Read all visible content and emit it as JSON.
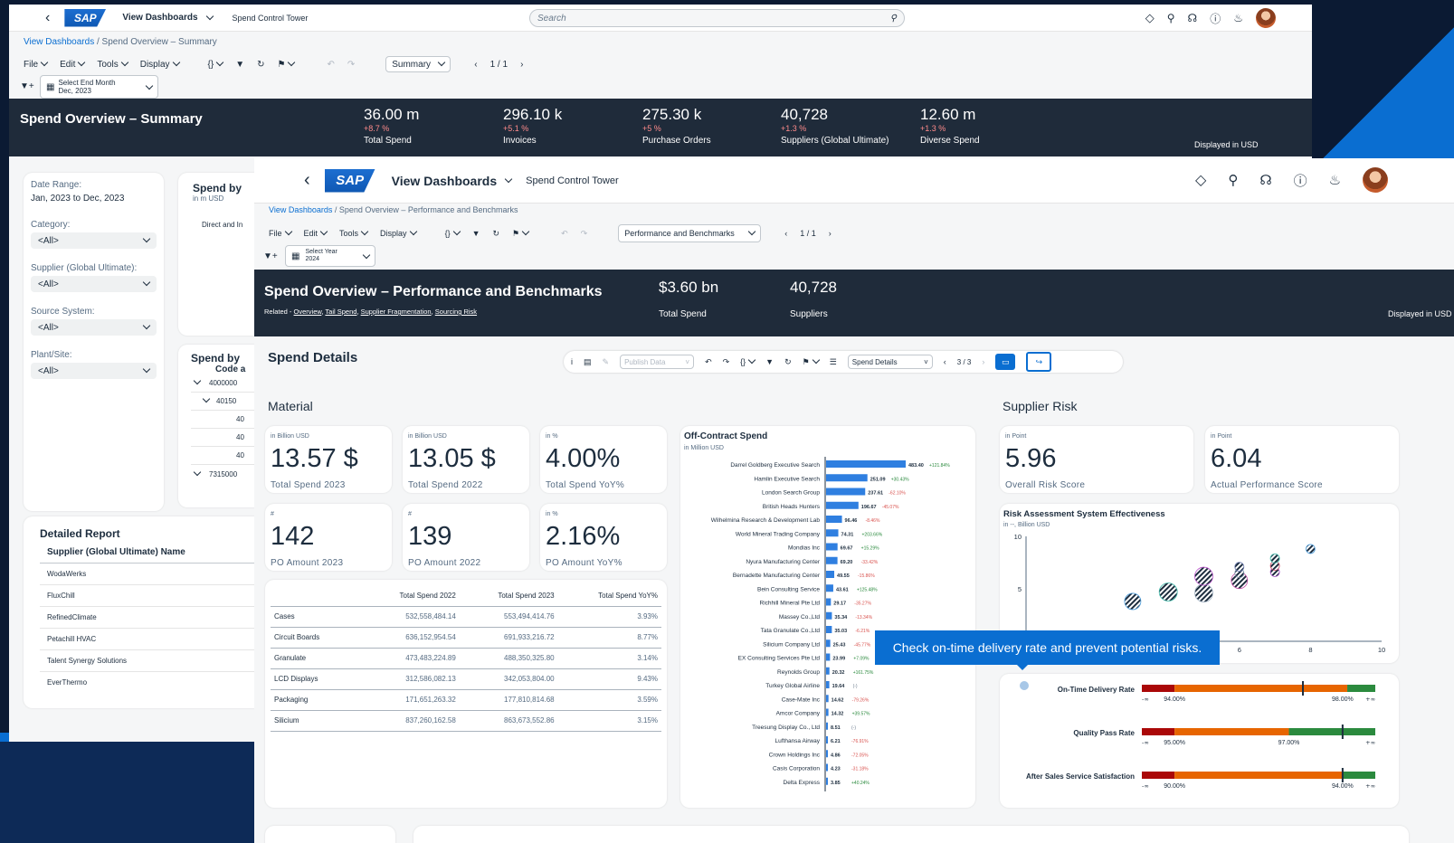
{
  "back_win": {
    "shell": {
      "title": "View Dashboards",
      "subtitle": "Spend Control Tower",
      "search_placeholder": "Search"
    },
    "breadcrumb": {
      "link": "View Dashboards",
      "current": " / Spend Overview – Summary"
    },
    "menus": [
      "File",
      "Edit",
      "Tools",
      "Display"
    ],
    "view_select": "Summary",
    "pager": "1 / 1",
    "filter": {
      "label": "Select End Month",
      "value": "Dec, 2023"
    },
    "header": {
      "title": "Spend Overview – Summary",
      "kpis": [
        {
          "value": "36.00 m",
          "delta": "+8.7 %",
          "label": "Total Spend"
        },
        {
          "value": "296.10 k",
          "delta": "+5.1 %",
          "label": "Invoices"
        },
        {
          "value": "275.30 k",
          "delta": "+5 %",
          "label": "Purchase Orders"
        },
        {
          "value": "40,728",
          "delta": "+1.3 %",
          "label": "Suppliers (Global Ultimate)"
        },
        {
          "value": "12.60 m",
          "delta": "+1.3 %",
          "label": "Diverse Spend"
        }
      ],
      "currency_note": "Displayed in USD"
    },
    "filters_panel": {
      "date_range_label": "Date Range:",
      "date_range_value": "Jan, 2023 to Dec, 2023",
      "fields": [
        {
          "label": "Category:",
          "value": "<All>"
        },
        {
          "label": "Supplier (Global Ultimate):",
          "value": "<All>"
        },
        {
          "label": "Source System:",
          "value": "<All>"
        },
        {
          "label": "Plant/Site:",
          "value": "<All>"
        }
      ]
    },
    "spend_by_card": {
      "title": "Spend by",
      "unit": "in m USD",
      "row": "Direct and In"
    },
    "spend_by_code_card": {
      "title": "Spend by",
      "subtitle": "Code a",
      "rows": [
        "4000000",
        "40150",
        "40",
        "40",
        "40",
        "7315000"
      ]
    },
    "detailed_report": {
      "title": "Detailed Report",
      "column": "Supplier (Global Ultimate) Name",
      "rows": [
        "WodaWerks",
        "FluxChill",
        "RefinedClimate",
        "Petachill HVAC",
        "Talent Synergy Solutions",
        "EverThermo"
      ]
    }
  },
  "front_win": {
    "shell": {
      "title": "View Dashboards",
      "subtitle": "Spend Control Tower"
    },
    "breadcrumb": {
      "link": "View Dashboards",
      "current": " / Spend Overview – Performance and Benchmarks"
    },
    "menus": [
      "File",
      "Edit",
      "Tools",
      "Display"
    ],
    "view_select": "Performance and Benchmarks",
    "pager": "1 / 1",
    "filter": {
      "label": "Select Year",
      "value": "2024"
    },
    "header": {
      "title": "Spend Overview – Performance and Benchmarks",
      "related_label": "Related - ",
      "related_links": [
        "Overview",
        "Tail Spend",
        "Supplier Fragmentation",
        "Sourcing Risk"
      ],
      "kpis": [
        {
          "value": "$3.60 bn",
          "label": "Total Spend"
        },
        {
          "value": "40,728",
          "label": "Suppliers"
        }
      ],
      "currency_note": "Displayed in USD"
    },
    "details_toolbar": {
      "title": "Spend Details",
      "publish": "Publish Data",
      "view_select": "Spend Details",
      "pager": "3 / 3"
    },
    "material": {
      "title": "Material",
      "tiles": [
        {
          "unit": "in Billion USD",
          "value": "13.57 $",
          "label": "Total Spend 2023"
        },
        {
          "unit": "in Billion USD",
          "value": "13.05 $",
          "label": "Total Spend 2022"
        },
        {
          "unit": "in %",
          "value": "4.00%",
          "label": "Total Spend YoY%"
        },
        {
          "unit": "#",
          "value": "142",
          "label": "PO Amount 2023"
        },
        {
          "unit": "#",
          "value": "139",
          "label": "PO Amount 2022"
        },
        {
          "unit": "in %",
          "value": "2.16%",
          "label": "PO Amount YoY%"
        }
      ],
      "table": {
        "headers": [
          "",
          "Total Spend 2022",
          "Total Spend 2023",
          "Total Spend YoY%"
        ],
        "rows": [
          [
            "Cases",
            "532,558,484.14",
            "553,494,414.76",
            "3.93%"
          ],
          [
            "Circuit Boards",
            "636,152,954.54",
            "691,933,216.72",
            "8.77%"
          ],
          [
            "Granulate",
            "473,483,224.89",
            "488,350,325.80",
            "3.14%"
          ],
          [
            "LCD Displays",
            "312,586,082.13",
            "342,053,804.00",
            "9.43%"
          ],
          [
            "Packaging",
            "171,651,263.32",
            "177,810,814.68",
            "3.59%"
          ],
          [
            "Silicium",
            "837,260,162.58",
            "863,673,552.86",
            "3.15%"
          ]
        ]
      }
    },
    "supplier_risk": {
      "title": "Supplier Risk",
      "tiles": [
        {
          "unit": "in Point",
          "value": "5.96",
          "label": "Overall Risk Score"
        },
        {
          "unit": "in Point",
          "value": "6.04",
          "label": "Actual Performance Score"
        }
      ]
    },
    "tooltip": "Check on-time delivery rate and prevent potential risks.",
    "bullets": [
      {
        "label": "On-Time Delivery Rate",
        "min": "-∞",
        "left": "94.00%",
        "right": "98.00%",
        "max": "+∞",
        "value_pct": 0.69,
        "red": 0.14,
        "orange": 0.88
      },
      {
        "label": "Quality Pass Rate",
        "min": "-∞",
        "left": "95.00%",
        "right": "97.00%",
        "max": "+∞",
        "value_pct": 0.86,
        "red": 0.14,
        "orange": 0.63
      },
      {
        "label": "After Sales Service Satisfaction",
        "min": "-∞",
        "left": "90.00%",
        "right": "94.00%",
        "max": "+∞",
        "value_pct": 0.86,
        "red": 0.14,
        "orange": 0.86
      }
    ]
  },
  "chart_data": [
    {
      "type": "bar",
      "title": "Off-Contract Spend",
      "subtitle": "in Million USD",
      "categories": [
        "Darrel Goldberg Executive Search",
        "Hamlin Executive Search",
        "London Search Group",
        "British Heads Hunters",
        "Wilhelmina Research & Development Lab",
        "World Mineral Trading Company",
        "Mondias Inc",
        "Nyura Manufacturing Center",
        "Bernadette Manufacturing Center",
        "Bein Consulting Service",
        "Richhill Mineral Pte Ltd",
        "Massey Co.,Ltd",
        "Tata Granulate Co.,Ltd",
        "Silicium Company Ltd",
        "EX Consulting Services Pte Ltd",
        "Reynolds Group",
        "Turkey Global Airline",
        "Case-Mate Inc",
        "Amcor Company",
        "Treesung Display Co., Ltd",
        "Lufthansa Airway",
        "Crown Holdings Inc",
        "Casis Corporation",
        "Delta Express"
      ],
      "values": [
        483.4,
        251.09,
        237.61,
        196.67,
        96.46,
        74.31,
        69.67,
        69.2,
        49.55,
        43.61,
        29.17,
        35.34,
        35.03,
        25.43,
        23.99,
        20.32,
        19.64,
        14.62,
        14.32,
        8.51,
        6.21,
        4.86,
        4.23,
        3.85
      ],
      "deltas": [
        "+121.84%",
        "+30.43%",
        "-62.10%",
        "-45.07%",
        "-8.46%",
        "+203.66%",
        "+15.29%",
        "-33.42%",
        "-15.86%",
        "+125.48%",
        "-35.27%",
        "-13.34%",
        "-6.21%",
        "-45.77%",
        "+7.09%",
        "+161.75%",
        "(-)",
        "-79.26%",
        "+39.57%",
        "(-)",
        "-76.91%",
        "-72.05%",
        "-31.18%",
        "+40.24%"
      ]
    },
    {
      "type": "scatter",
      "title": "Risk Assessment System Effectiveness",
      "subtitle": "in --, Billion USD",
      "xlim": [
        0,
        10
      ],
      "ylim": [
        0,
        10
      ],
      "x_ticks": [
        "6",
        "8",
        "10"
      ],
      "y_ticks": [
        "10",
        "5"
      ],
      "points": [
        {
          "x": 3.0,
          "y": 3.8,
          "color": "#4f9dd9",
          "r": 9
        },
        {
          "x": 4.0,
          "y": 4.7,
          "color": "#3fb8a8",
          "r": 10
        },
        {
          "x": 5.0,
          "y": 4.6,
          "color": "#a8b7c7",
          "r": 10
        },
        {
          "x": 5.0,
          "y": 6.2,
          "color": "#b94fc9",
          "r": 10
        },
        {
          "x": 6.0,
          "y": 5.8,
          "color": "#c64fa8",
          "r": 9
        },
        {
          "x": 6.0,
          "y": 6.5,
          "color": "#7a8fa5",
          "r": 5
        },
        {
          "x": 6.0,
          "y": 7.1,
          "color": "#6d7bb0",
          "r": 5
        },
        {
          "x": 7.0,
          "y": 6.6,
          "color": "#a84fc9",
          "r": 5
        },
        {
          "x": 7.0,
          "y": 7.2,
          "color": "#d04f6a",
          "r": 5
        },
        {
          "x": 7.0,
          "y": 7.9,
          "color": "#3fb8a8",
          "r": 5
        },
        {
          "x": 8.0,
          "y": 8.8,
          "color": "#4f9dd9",
          "r": 5
        }
      ]
    }
  ]
}
